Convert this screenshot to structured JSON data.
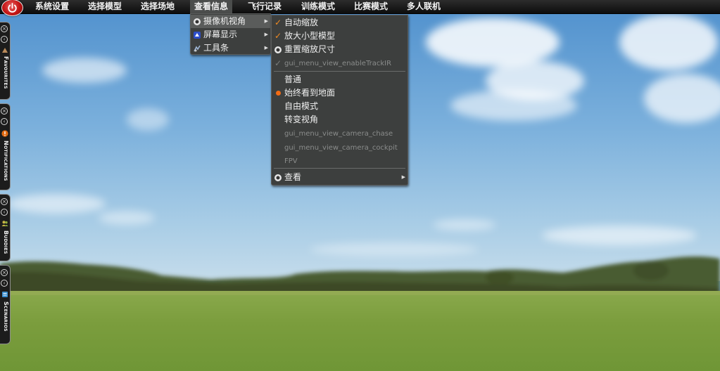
{
  "menubar": {
    "items": [
      {
        "label": "系统设置"
      },
      {
        "label": "选择模型"
      },
      {
        "label": "选择场地"
      },
      {
        "label": "查看信息",
        "active": true
      },
      {
        "label": "飞行记录"
      },
      {
        "label": "训练模式"
      },
      {
        "label": "比赛模式"
      },
      {
        "label": "多人联机"
      }
    ]
  },
  "view_menu": {
    "items": [
      {
        "label": "摄像机视角",
        "icon": "camera-icon",
        "submenu": true,
        "highlighted": true
      },
      {
        "label": "屏幕显示",
        "icon": "display-icon",
        "submenu": true
      },
      {
        "label": "工具条",
        "icon": "toolbar-icon",
        "submenu": true
      }
    ]
  },
  "camera_menu": {
    "items": [
      {
        "label": "自动缩放",
        "state": "checked"
      },
      {
        "label": "放大小型模型",
        "state": "checked"
      },
      {
        "label": "重置缩放尺寸",
        "icon": "camera-icon"
      },
      {
        "label": "gui_menu_view_enableTrackIR",
        "state": "checked-disabled",
        "disabled": true
      },
      {
        "label": "普通"
      },
      {
        "label": "始终看到地面",
        "state": "radio-selected"
      },
      {
        "label": "自由模式"
      },
      {
        "label": "转变视角"
      },
      {
        "label": "gui_menu_view_camera_chase",
        "disabled": true
      },
      {
        "label": "gui_menu_view_camera_cockpit",
        "disabled": true
      },
      {
        "label": "FPV",
        "disabled": true
      },
      {
        "label": "查看",
        "icon": "camera-icon",
        "submenu": true
      }
    ]
  },
  "side_tabs": [
    {
      "label": "Favourites",
      "icon": "favourites-icon"
    },
    {
      "label": "Notifications",
      "icon": "alert-icon"
    },
    {
      "label": "Buddies",
      "icon": "buddies-icon"
    },
    {
      "label": "Scenarios",
      "icon": "scenarios-icon"
    }
  ],
  "colors": {
    "menubar_bg": "#141414",
    "menu_bg": "#3d3f3e",
    "menu_highlight": "#5a5c5b",
    "check_accent": "#f08a22",
    "power_button": "#c41515",
    "sky": "#86b6dc",
    "grass": "#7fa344"
  }
}
